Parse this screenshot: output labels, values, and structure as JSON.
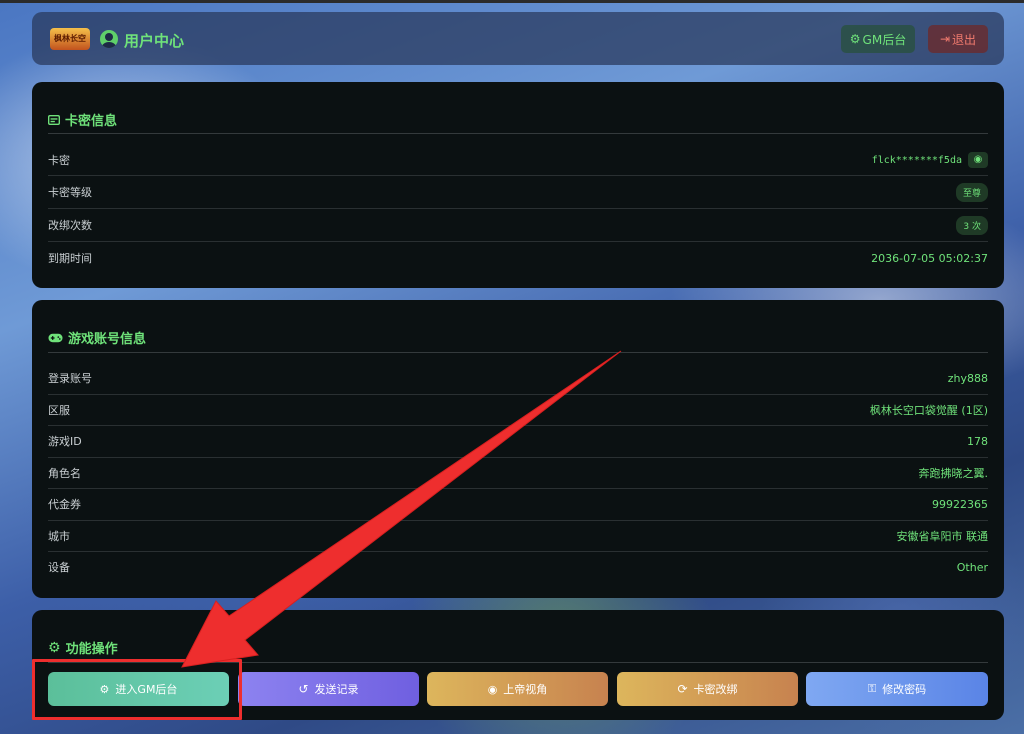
{
  "header": {
    "logo_text": "枫林长空",
    "title": "用户中心",
    "gm_button": "GM后台",
    "logout_button": "退出"
  },
  "card_info": {
    "title": "卡密信息",
    "rows": [
      {
        "label": "卡密",
        "value": "flck*******f5da"
      },
      {
        "label": "卡密等级",
        "value": "至尊"
      },
      {
        "label": "改绑次数",
        "value": "3 次"
      },
      {
        "label": "到期时间",
        "value": "2036-07-05 05:02:37"
      }
    ]
  },
  "game_account": {
    "title": "游戏账号信息",
    "rows": [
      {
        "label": "登录账号",
        "value": "zhy888"
      },
      {
        "label": "区服",
        "value": "枫林长空口袋觉醒 (1区)"
      },
      {
        "label": "游戏ID",
        "value": "178"
      },
      {
        "label": "角色名",
        "value": "奔跑拂晓之翼."
      },
      {
        "label": "代金券",
        "value": "99922365"
      },
      {
        "label": "城市",
        "value": "安徽省阜阳市 联通"
      },
      {
        "label": "设备",
        "value": "Other"
      }
    ]
  },
  "actions": {
    "title": "功能操作",
    "buttons": [
      {
        "label": "进入GM后台",
        "icon": "gears-icon"
      },
      {
        "label": "发送记录",
        "icon": "history-icon"
      },
      {
        "label": "上帝视角",
        "icon": "eye-icon"
      },
      {
        "label": "卡密改绑",
        "icon": "sync-icon"
      },
      {
        "label": "修改密码",
        "icon": "key-icon"
      }
    ]
  },
  "colors": {
    "accent_green": "#6fe27a",
    "card_bg": "#0b1112",
    "annotation_red": "#ee2e2e"
  }
}
